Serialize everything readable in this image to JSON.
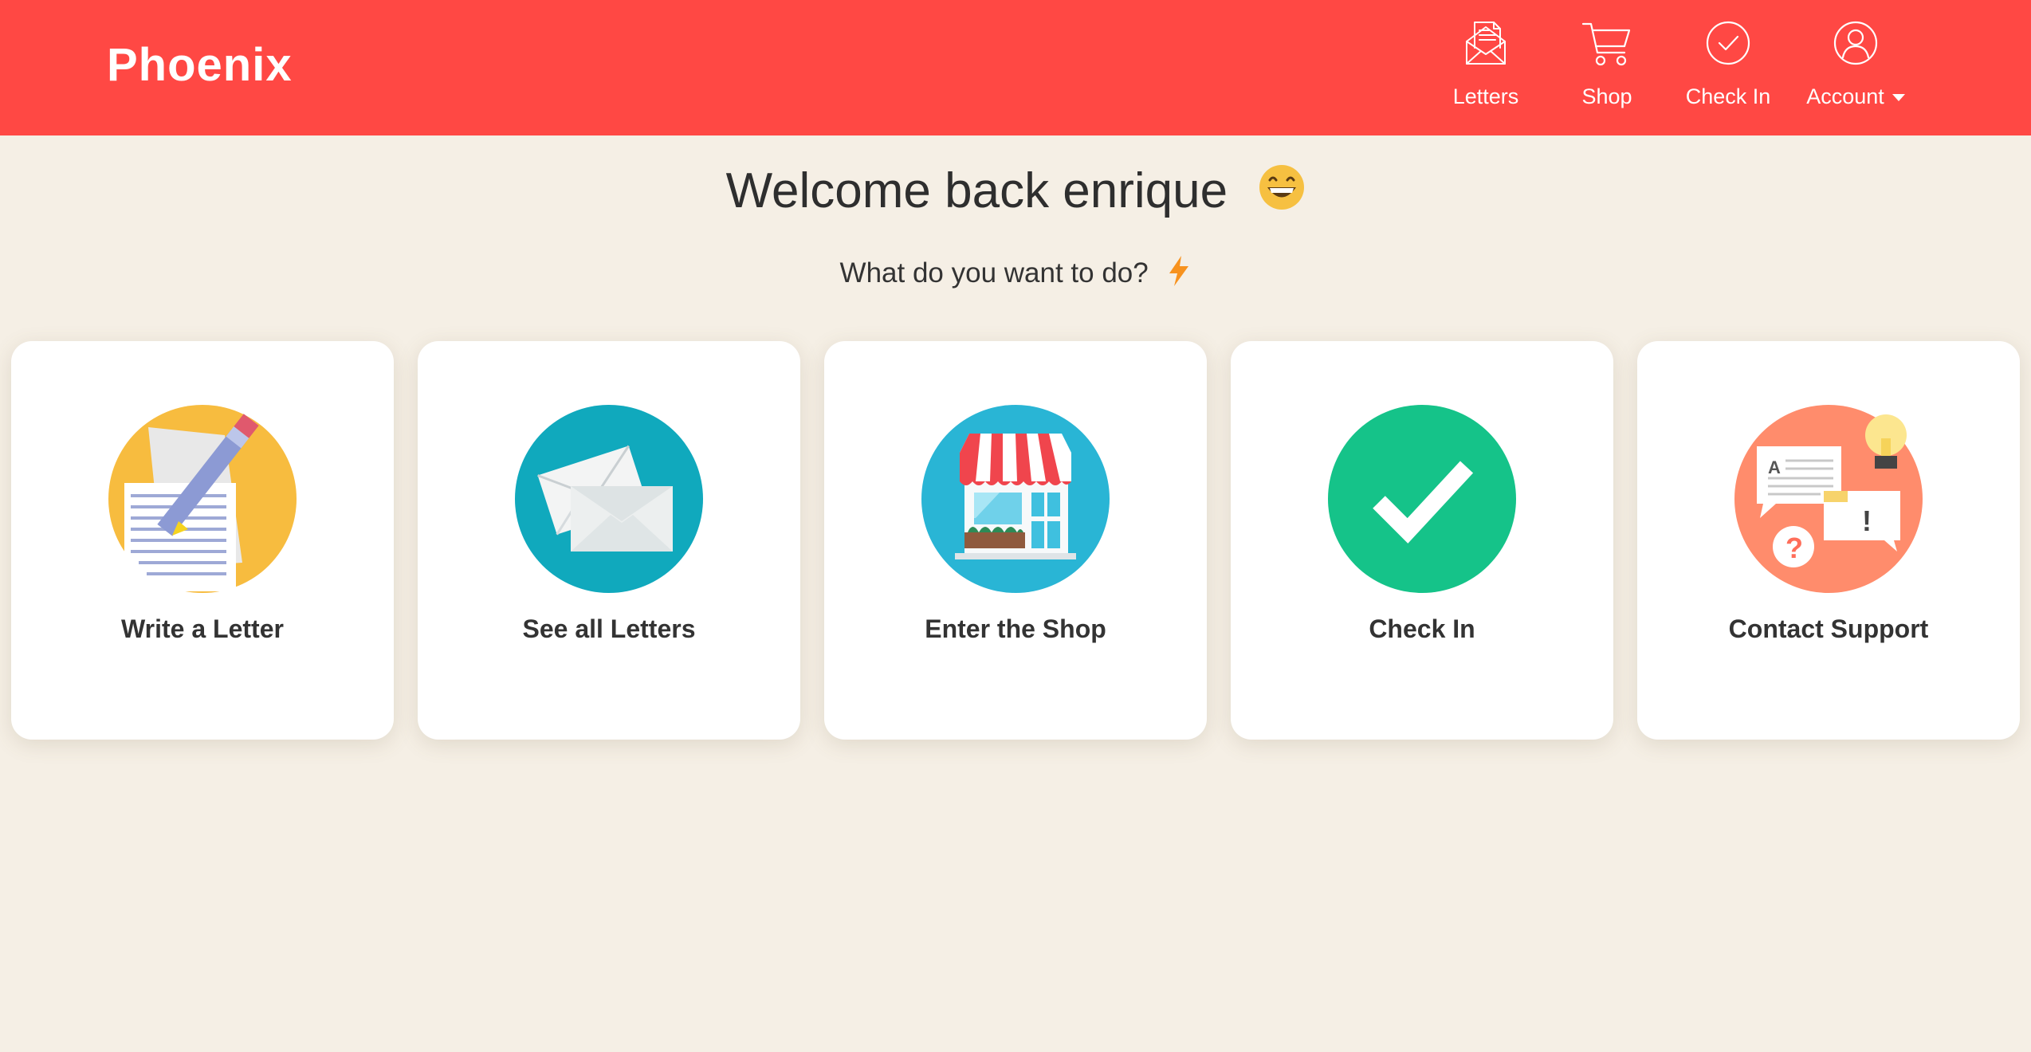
{
  "brand": "Phoenix",
  "nav": {
    "items": [
      {
        "label": "Letters",
        "icon": "letters-icon"
      },
      {
        "label": "Shop",
        "icon": "cart-icon"
      },
      {
        "label": "Check In",
        "icon": "check-circle-icon"
      },
      {
        "label": "Account",
        "icon": "user-icon",
        "dropdown": true
      }
    ]
  },
  "welcome": {
    "title": "Welcome back enrique",
    "emoji": "grinning-face-icon"
  },
  "subtitle": {
    "text": "What do you want to do?",
    "emoji": "lightning-icon"
  },
  "cards": [
    {
      "label": "Write a Letter",
      "icon": "write-letter-icon"
    },
    {
      "label": "See all Letters",
      "icon": "envelopes-icon"
    },
    {
      "label": "Enter the Shop",
      "icon": "storefront-icon"
    },
    {
      "label": "Check In",
      "icon": "checkmark-icon"
    },
    {
      "label": "Contact Support",
      "icon": "support-chat-icon"
    }
  ],
  "colors": {
    "header": "#ff4844",
    "background": "#f5efe5",
    "card": "#ffffff",
    "text": "#333333"
  }
}
